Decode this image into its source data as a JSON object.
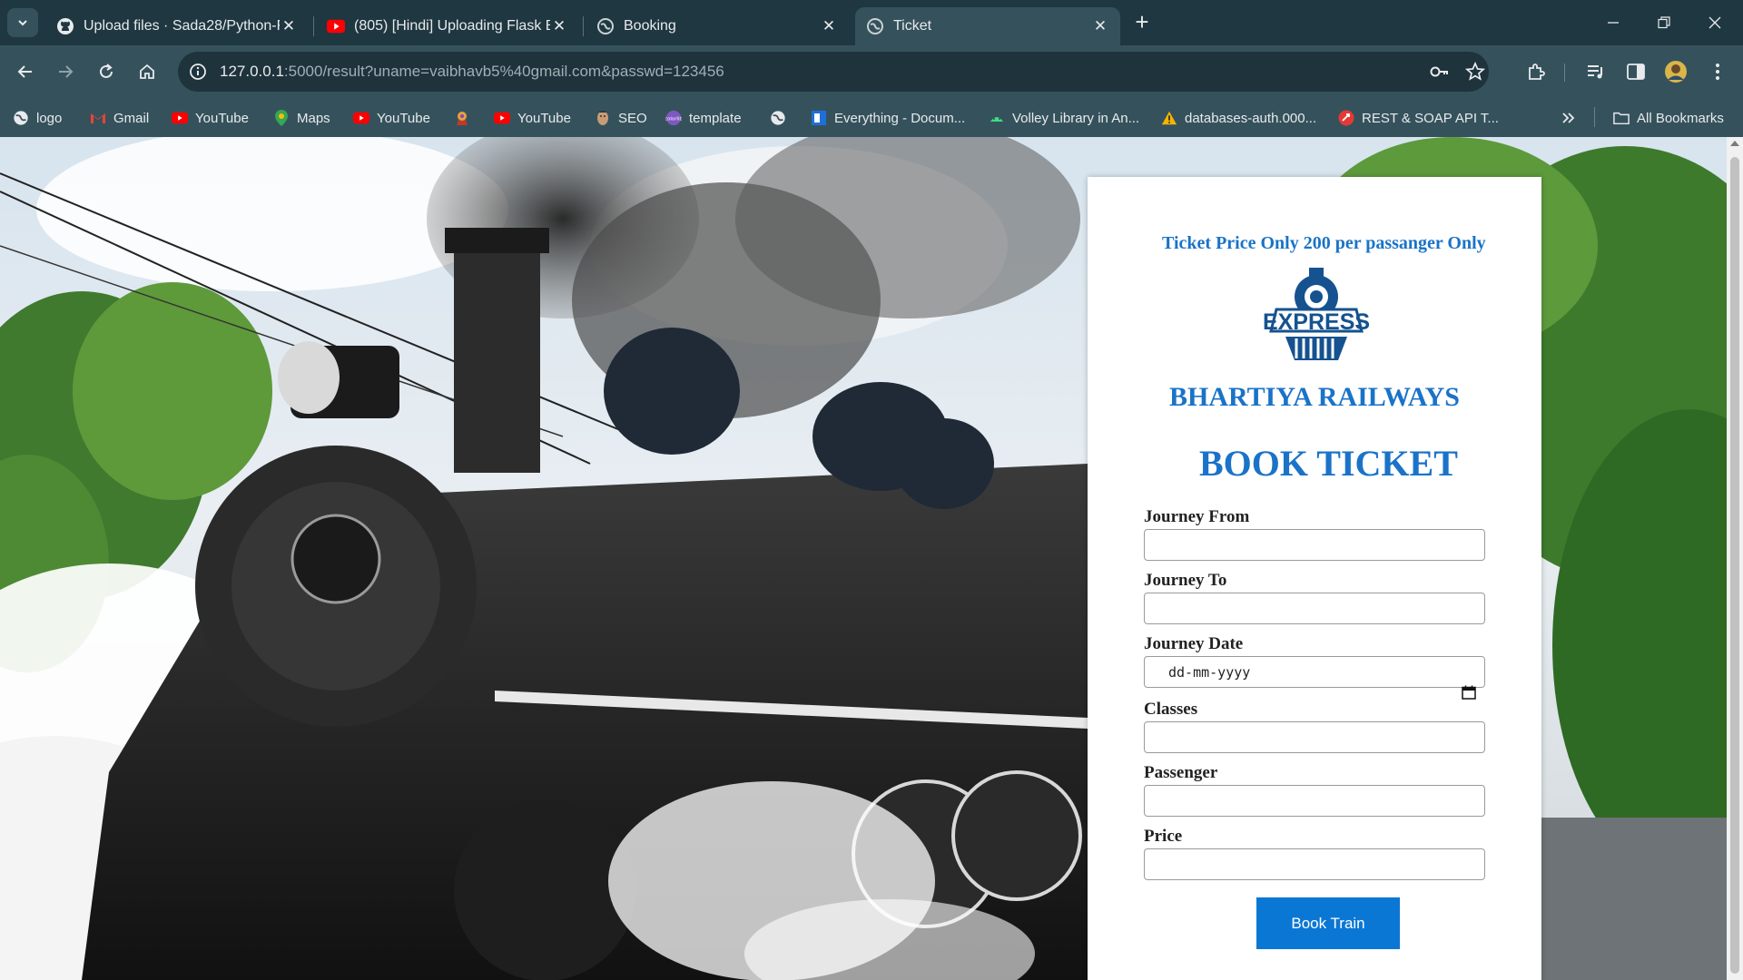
{
  "browser": {
    "tabs": [
      {
        "title": "Upload files · Sada28/Python-Fl",
        "icon": "github-icon"
      },
      {
        "title": "(805) [Hindi] Uploading Flask Bl",
        "icon": "youtube-icon"
      },
      {
        "title": "Booking",
        "icon": "globe-icon"
      },
      {
        "title": "Ticket",
        "icon": "globe-icon",
        "active": true
      }
    ],
    "url_host": "127.0.0.1",
    "url_rest": ":5000/result?uname=vaibhavb5%40gmail.com&passwd=123456",
    "bookmarks": [
      {
        "label": "logo",
        "icon": "globe-icon"
      },
      {
        "label": "Gmail",
        "icon": "gmail-icon"
      },
      {
        "label": "YouTube",
        "icon": "youtube-icon"
      },
      {
        "label": "Maps",
        "icon": "maps-icon"
      },
      {
        "label": "YouTube",
        "icon": "youtube-icon"
      },
      {
        "label": "",
        "icon": "emblem-icon"
      },
      {
        "label": "YouTube",
        "icon": "youtube-icon"
      },
      {
        "label": "SEO",
        "icon": "face-icon"
      },
      {
        "label": "template",
        "icon": "colorlib-icon"
      },
      {
        "label": "",
        "icon": "globe-icon"
      },
      {
        "label": "Everything - Docum...",
        "icon": "doc-icon"
      },
      {
        "label": "Volley Library in An...",
        "icon": "android-icon"
      },
      {
        "label": "databases-auth.000...",
        "icon": "warning-icon"
      },
      {
        "label": "REST & SOAP API T...",
        "icon": "api-icon"
      }
    ],
    "all_bookmarks_label": "All Bookmarks"
  },
  "page": {
    "price_note": "Ticket Price Only 200 per passanger Only",
    "logo_text": "EXPRESS",
    "brand": "BHARTIYA RAILWAYS",
    "heading": "BOOK TICKET",
    "fields": [
      {
        "label": "Journey From",
        "value": ""
      },
      {
        "label": "Journey To",
        "value": ""
      },
      {
        "label": "Journey Date",
        "placeholder": "dd-mm-yyyy"
      },
      {
        "label": "Classes",
        "value": ""
      },
      {
        "label": "Passenger",
        "value": ""
      },
      {
        "label": "Price",
        "value": ""
      }
    ],
    "submit_label": "Book Train"
  },
  "colors": {
    "accent": "#1a73c8",
    "button": "#0b77d4",
    "tabstrip": "#1f3740",
    "toolbar": "#35525c"
  }
}
